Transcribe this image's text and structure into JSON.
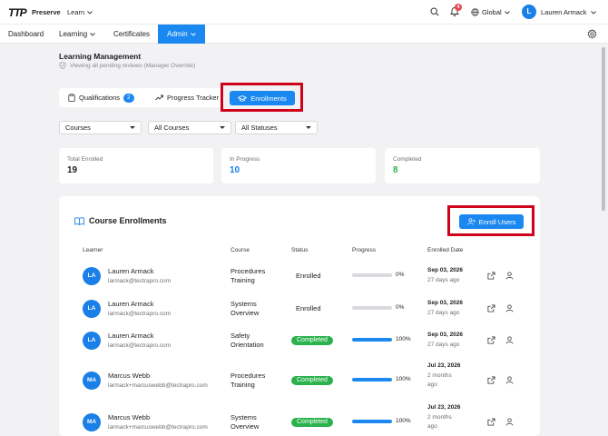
{
  "topbar": {
    "logo_text": "TTP",
    "brand": "Preserve",
    "learn_menu": "Learn",
    "notification_count": "4",
    "global_label": "Global",
    "user_initial": "L",
    "user_name": "Lauren Armack"
  },
  "nav": {
    "items": [
      "Dashboard",
      "Learning",
      "Certificates",
      "Admin"
    ],
    "active": "Admin"
  },
  "page": {
    "title": "Learning Management",
    "subtitle": "Viewing all pending reviews (Manager Override)"
  },
  "tabs": {
    "qualifications": "Qualifications",
    "qualifications_count": "2",
    "progress": "Progress Tracker",
    "enrollments": "Enrollments"
  },
  "filters": {
    "type": "Courses",
    "course": "All Courses",
    "status": "All Statuses"
  },
  "stats": [
    {
      "label": "Total Enrolled",
      "value": "19",
      "color": "#1d1d1f"
    },
    {
      "label": "In Progress",
      "value": "10",
      "color": "#1a7fe6"
    },
    {
      "label": "Completed",
      "value": "8",
      "color": "#2bb24c"
    }
  ],
  "enrollments": {
    "title": "Course Enrollments",
    "enroll_button": "Enroll Users",
    "columns": [
      "Learner",
      "Course",
      "Status",
      "Progress",
      "Enrolled Date"
    ],
    "rows": [
      {
        "initials": "LA",
        "name": "Lauren Armack",
        "email": "larmack@tectrapro.com",
        "course1": "Procedures",
        "course2": "Training",
        "status": "Enrolled",
        "completed": false,
        "progress": 0,
        "progress_label": "0%",
        "date": "Sep 03, 2026",
        "ago1": "27 days ago",
        "ago2": ""
      },
      {
        "initials": "LA",
        "name": "Lauren Armack",
        "email": "larmack@tectrapro.com",
        "course1": "Systems",
        "course2": "Overview",
        "status": "Enrolled",
        "completed": false,
        "progress": 0,
        "progress_label": "0%",
        "date": "Sep 03, 2026",
        "ago1": "27 days ago",
        "ago2": ""
      },
      {
        "initials": "LA",
        "name": "Lauren Armack",
        "email": "larmack@tectrapro.com",
        "course1": "Safety",
        "course2": "Orientation",
        "status": "Completed",
        "completed": true,
        "progress": 100,
        "progress_label": "100%",
        "date": "Sep 03, 2026",
        "ago1": "27 days ago",
        "ago2": ""
      },
      {
        "initials": "MA",
        "name": "Marcus Webb",
        "email": "larmack+marcuswebb@tectrapro.com",
        "course1": "Procedures",
        "course2": "Training",
        "status": "Completed",
        "completed": true,
        "progress": 100,
        "progress_label": "100%",
        "date": "Jul 23, 2026",
        "ago1": "2 months",
        "ago2": "ago"
      },
      {
        "initials": "MA",
        "name": "Marcus Webb",
        "email": "larmack+marcuswebb@tectrapro.com",
        "course1": "Systems",
        "course2": "Overview",
        "status": "Completed",
        "completed": true,
        "progress": 100,
        "progress_label": "100%",
        "date": "Jul 23, 2026",
        "ago1": "2 months",
        "ago2": "ago"
      }
    ]
  },
  "icons": {
    "search": "search-icon",
    "bell": "bell-icon",
    "globe": "globe-icon",
    "gear": "gear-icon",
    "shield": "shield-check-icon",
    "book": "book-open-icon",
    "clipboard": "clipboard-icon",
    "trend": "trending-up-icon",
    "cap": "graduation-cap-icon",
    "add_user": "user-plus-icon",
    "open": "external-link-icon",
    "user": "user-icon"
  },
  "colors": {
    "accent": "#1a88f0",
    "success": "#2bb24c",
    "highlight": "#d0021b",
    "badge": "#e5484d"
  }
}
